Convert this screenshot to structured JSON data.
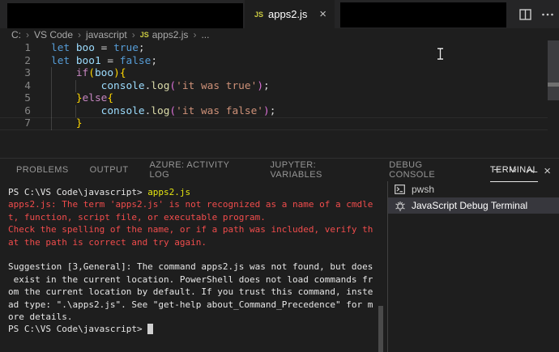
{
  "colors": {
    "tabbar_bg": "#252526",
    "editor_bg": "#1e1e1e",
    "error_red": "#f14c4c",
    "command_yellow": "#e5e510",
    "selection_bg": "#37373d",
    "js_icon_yellow": "#cbcb41",
    "active_tab_underline": "#e7e7e7"
  },
  "tab_bar": {
    "active_tab": {
      "icon": "js-file-icon",
      "label": "apps2.js",
      "close_glyph": "×"
    },
    "actions": [
      {
        "name": "split-editor-icon"
      },
      {
        "name": "more-actions-icon"
      }
    ]
  },
  "breadcrumb": {
    "items": [
      {
        "label": "C:"
      },
      {
        "label": "VS Code"
      },
      {
        "label": "javascript"
      },
      {
        "label": "apps2.js",
        "icon": "js-file-icon",
        "icon_text": "JS"
      },
      {
        "label": "..."
      }
    ]
  },
  "editor": {
    "lines": [
      {
        "num": "1",
        "segments": [
          {
            "t": "let ",
            "c": "kw"
          },
          {
            "t": "boo",
            "c": "var"
          },
          {
            "t": " = ",
            "c": "plain"
          },
          {
            "t": "true",
            "c": "kw"
          },
          {
            "t": ";",
            "c": "plain"
          }
        ]
      },
      {
        "num": "2",
        "segments": [
          {
            "t": "let ",
            "c": "kw"
          },
          {
            "t": "boo1",
            "c": "var"
          },
          {
            "t": " = ",
            "c": "plain"
          },
          {
            "t": "false",
            "c": "kw"
          },
          {
            "t": ";",
            "c": "plain"
          }
        ]
      },
      {
        "num": "3",
        "segments": [
          {
            "t": "    ",
            "c": "plain"
          },
          {
            "t": "if",
            "c": "ctrl"
          },
          {
            "t": "(",
            "c": "b1"
          },
          {
            "t": "boo",
            "c": "var"
          },
          {
            "t": ")",
            "c": "b1"
          },
          {
            "t": "{",
            "c": "b1"
          }
        ]
      },
      {
        "num": "4",
        "segments": [
          {
            "t": "        ",
            "c": "plain"
          },
          {
            "t": "console",
            "c": "var"
          },
          {
            "t": ".",
            "c": "plain"
          },
          {
            "t": "log",
            "c": "fn"
          },
          {
            "t": "(",
            "c": "p2"
          },
          {
            "t": "'it was true'",
            "c": "str"
          },
          {
            "t": ")",
            "c": "p2"
          },
          {
            "t": ";",
            "c": "plain"
          }
        ]
      },
      {
        "num": "5",
        "segments": [
          {
            "t": "    ",
            "c": "plain"
          },
          {
            "t": "}",
            "c": "b1"
          },
          {
            "t": "else",
            "c": "ctrl"
          },
          {
            "t": "{",
            "c": "b1"
          }
        ]
      },
      {
        "num": "6",
        "segments": [
          {
            "t": "        ",
            "c": "plain"
          },
          {
            "t": "console",
            "c": "var"
          },
          {
            "t": ".",
            "c": "plain"
          },
          {
            "t": "log",
            "c": "fn"
          },
          {
            "t": "(",
            "c": "p2"
          },
          {
            "t": "'it was false'",
            "c": "str"
          },
          {
            "t": ")",
            "c": "p2"
          },
          {
            "t": ";",
            "c": "plain"
          }
        ]
      },
      {
        "num": "7",
        "segments": [
          {
            "t": "    ",
            "c": "plain"
          },
          {
            "t": "}",
            "c": "b1"
          }
        ]
      }
    ]
  },
  "panel": {
    "tabs": [
      {
        "label": "PROBLEMS",
        "active": false
      },
      {
        "label": "OUTPUT",
        "active": false
      },
      {
        "label": "AZURE: ACTIVITY LOG",
        "active": false
      },
      {
        "label": "JUPYTER: VARIABLES",
        "active": false
      },
      {
        "label": "DEBUG CONSOLE",
        "active": false
      },
      {
        "label": "TERMINAL",
        "active": true
      }
    ],
    "actions": [
      {
        "name": "new-terminal-icon",
        "glyph": "+"
      },
      {
        "name": "terminal-dropdown-icon",
        "glyph": "v"
      },
      {
        "name": "maximize-panel-icon",
        "glyph": "^"
      },
      {
        "name": "close-panel-icon",
        "glyph": "×"
      }
    ]
  },
  "terminal": {
    "lines": [
      {
        "segments": [
          {
            "t": "PS C:\\VS Code\\javascript> ",
            "c": "plain"
          },
          {
            "t": "apps2.js",
            "c": "cmd"
          }
        ]
      },
      {
        "segments": [
          {
            "t": "apps2.js: The term 'apps2.js' is not recognized as a name of a cmdle",
            "c": "err"
          }
        ]
      },
      {
        "segments": [
          {
            "t": "t, function, script file, or executable program.",
            "c": "err"
          }
        ]
      },
      {
        "segments": [
          {
            "t": "Check the spelling of the name, or if a path was included, verify th",
            "c": "err"
          }
        ]
      },
      {
        "segments": [
          {
            "t": "at the path is correct and try again.",
            "c": "err"
          }
        ]
      },
      {
        "segments": [
          {
            "t": "",
            "c": "plain"
          }
        ]
      },
      {
        "segments": [
          {
            "t": "Suggestion [3,General]: The command apps2.js was not found, but does",
            "c": "plain"
          }
        ]
      },
      {
        "segments": [
          {
            "t": " exist in the current location. PowerShell does not load commands fr",
            "c": "plain"
          }
        ]
      },
      {
        "segments": [
          {
            "t": "om the current location by default. If you trust this command, inste",
            "c": "plain"
          }
        ]
      },
      {
        "segments": [
          {
            "t": "ad type: \".\\apps2.js\". See \"get-help about_Command_Precedence\" for m",
            "c": "plain"
          }
        ]
      },
      {
        "segments": [
          {
            "t": "ore details.",
            "c": "plain"
          }
        ]
      },
      {
        "segments": [
          {
            "t": "PS C:\\VS Code\\javascript> ",
            "c": "plain"
          },
          {
            "t": " ",
            "c": "cursor"
          }
        ]
      }
    ]
  },
  "terminal_sidebar": {
    "items": [
      {
        "label": "pwsh",
        "icon": "terminal-icon",
        "selected": false
      },
      {
        "label": "JavaScript Debug Terminal",
        "icon": "debug-icon",
        "selected": true
      }
    ]
  }
}
